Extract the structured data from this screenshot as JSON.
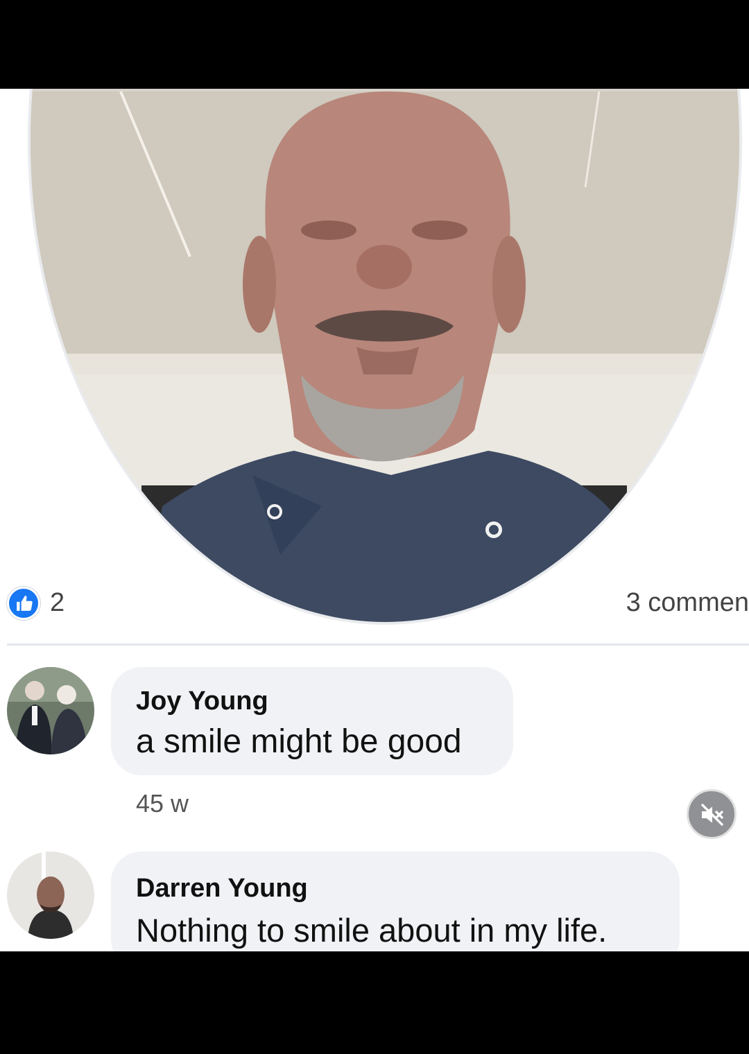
{
  "post": {
    "like_count": "2",
    "comment_count": "3 commen"
  },
  "comments": [
    {
      "author": "Joy Young",
      "text": "a smile might be good",
      "timestamp": "45 w"
    },
    {
      "author": "Darren Young",
      "text": "Nothing to smile about in my life."
    }
  ],
  "icons": {
    "like": "thumbs-up-icon",
    "mute": "speaker-muted-icon"
  },
  "colors": {
    "like_badge": "#1877f2",
    "bubble": "#f0f2f5",
    "background": "#ffffff"
  }
}
